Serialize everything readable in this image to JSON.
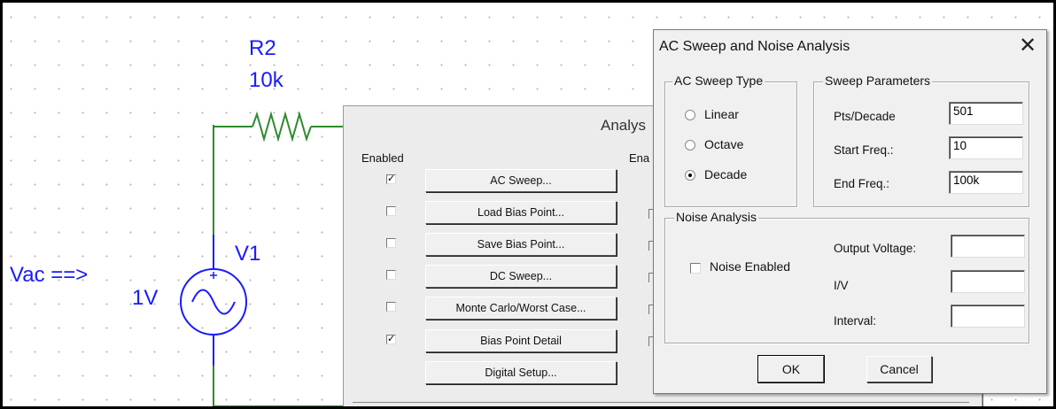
{
  "schematic": {
    "resistor_name": "R2",
    "resistor_value": "10k",
    "source_name": "V1",
    "source_value": "1V",
    "annotation": "Vac ==>"
  },
  "analysis_window": {
    "title_partial": "Analys",
    "enabled_header": "Enabled",
    "enabled_header_2": "Ena",
    "buttons": [
      {
        "label": "AC Sweep...",
        "checked": true
      },
      {
        "label": "Load Bias Point...",
        "checked": false
      },
      {
        "label": "Save Bias Point...",
        "checked": false
      },
      {
        "label": "DC Sweep...",
        "checked": false
      },
      {
        "label": "Monte Carlo/Worst Case...",
        "checked": false
      },
      {
        "label": "Bias Point Detail",
        "checked": true
      },
      {
        "label": "Digital Setup...",
        "checked": null
      }
    ]
  },
  "dialog": {
    "title": "AC Sweep and Noise Analysis",
    "close_glyph": "✕",
    "sweep_type": {
      "label": "AC Sweep Type",
      "options": [
        "Linear",
        "Octave",
        "Decade"
      ],
      "selected": "Decade"
    },
    "sweep_params": {
      "label": "Sweep Parameters",
      "pts_label": "Pts/Decade",
      "pts_value": "501",
      "start_label": "Start Freq.:",
      "start_value": "10",
      "end_label": "End Freq.:",
      "end_value": "100k"
    },
    "noise": {
      "label": "Noise Analysis",
      "enabled_label": "Noise Enabled",
      "enabled": false,
      "output_label": "Output Voltage:",
      "output_value": "",
      "iv_label": "I/V",
      "iv_value": "",
      "interval_label": "Interval:",
      "interval_value": ""
    },
    "ok_label": "OK",
    "cancel_label": "Cancel"
  }
}
